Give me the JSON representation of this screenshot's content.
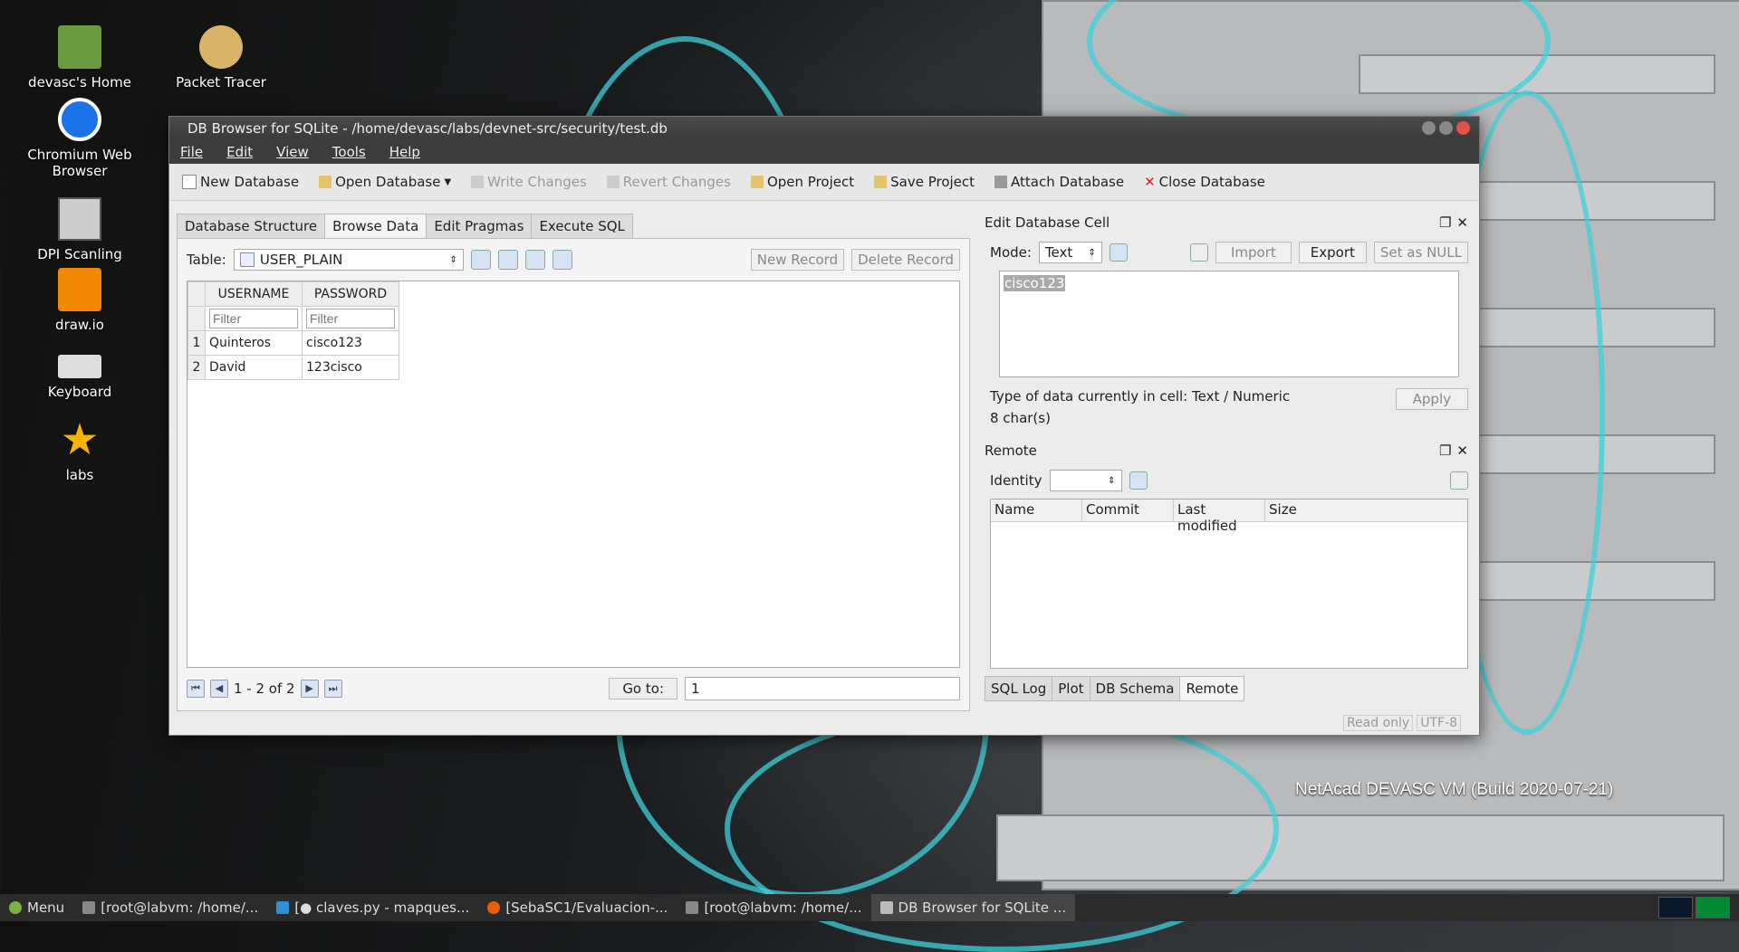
{
  "desktop": {
    "icons": [
      {
        "label": "devasc's Home",
        "icon": "folder-home-icon"
      },
      {
        "label": "Packet Tracer",
        "icon": "packet-tracer-icon"
      },
      {
        "label": "Chromium Web Browser",
        "icon": "chromium-icon"
      },
      {
        "label": "DPI Scanling",
        "icon": "dpi-scaling-icon"
      },
      {
        "label": "draw.io",
        "icon": "drawio-icon"
      },
      {
        "label": "Keyboard",
        "icon": "keyboard-icon"
      },
      {
        "label": "labs",
        "icon": "star-icon"
      }
    ],
    "watermark": "NetAcad DEVASC VM (Build 2020-07-21)"
  },
  "window": {
    "title": "DB Browser for SQLite - /home/devasc/labs/devnet-src/security/test.db",
    "menu": [
      "File",
      "Edit",
      "View",
      "Tools",
      "Help"
    ],
    "toolbar": {
      "new_database": "New Database",
      "open_database": "Open Database",
      "write_changes": "Write Changes",
      "revert_changes": "Revert Changes",
      "open_project": "Open Project",
      "save_project": "Save Project",
      "attach_database": "Attach Database",
      "close_database": "Close Database"
    },
    "tabs": [
      "Database Structure",
      "Browse Data",
      "Edit Pragmas",
      "Execute SQL"
    ],
    "browse": {
      "table_label": "Table:",
      "table_value": "USER_PLAIN",
      "new_record": "New Record",
      "delete_record": "Delete Record",
      "columns": [
        "USERNAME",
        "PASSWORD"
      ],
      "filter_placeholder": "Filter",
      "rows": [
        {
          "n": "1",
          "username": "Quinteros",
          "password": "cisco123"
        },
        {
          "n": "2",
          "username": "David",
          "password": "123cisco"
        }
      ],
      "record_range": "1 - 2 of 2",
      "goto_label": "Go to:",
      "goto_value": "1"
    },
    "edit_cell": {
      "title": "Edit Database Cell",
      "mode_label": "Mode:",
      "mode_value": "Text",
      "import": "Import",
      "export": "Export",
      "set_null": "Set as NULL",
      "cell_value": "cisco123",
      "type_info": "Type of data currently in cell: Text / Numeric",
      "size_info": "8 char(s)",
      "apply": "Apply"
    },
    "remote": {
      "title": "Remote",
      "identity_label": "Identity",
      "columns": [
        "Name",
        "Commit",
        "Last modified",
        "Size"
      ]
    },
    "bottom_tabs": [
      "SQL Log",
      "Plot",
      "DB Schema",
      "Remote"
    ],
    "status": {
      "read_only": "Read only",
      "encoding": "UTF-8"
    }
  },
  "taskbar": {
    "menu": "Menu",
    "tasks": [
      "[root@labvm: /home/...",
      "[● claves.py - mapques...",
      "[SebaSC1/Evaluacion-...",
      "[root@labvm: /home/...",
      "DB Browser for SQLite ..."
    ]
  }
}
